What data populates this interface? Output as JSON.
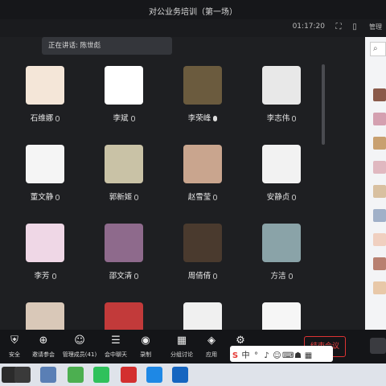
{
  "window": {
    "title": "对公业务培训（第一场）",
    "time": "01:17:20",
    "manage_label": "管理"
  },
  "speaking": {
    "label": "正在讲话: 陈世彪"
  },
  "participants": [
    {
      "name": "石维娜",
      "avatar_color": "#f4e6d8"
    },
    {
      "name": "李斌",
      "avatar_color": "#ffffff"
    },
    {
      "name": "李荣峰",
      "avatar_color": "#6b5b3e"
    },
    {
      "name": "李志伟",
      "avatar_color": "#e8e8e8"
    },
    {
      "name": "董文静",
      "avatar_color": "#f5f5f5"
    },
    {
      "name": "郭新姬",
      "avatar_color": "#c9c2a6"
    },
    {
      "name": "赵雪莹",
      "avatar_color": "#c9a58e"
    },
    {
      "name": "安静贞",
      "avatar_color": "#f2f2f2"
    },
    {
      "name": "李芳",
      "avatar_color": "#efd7e6"
    },
    {
      "name": "邵文清",
      "avatar_color": "#8e6a8c"
    },
    {
      "name": "周倩倩",
      "avatar_color": "#4a3a2e"
    },
    {
      "name": "方洁",
      "avatar_color": "#8aa3a8"
    },
    {
      "name": "",
      "avatar_color": "#d9c8b8"
    },
    {
      "name": "",
      "avatar_color": "#c23a3a"
    },
    {
      "name": "",
      "avatar_color": "#f0f0f0"
    },
    {
      "name": "",
      "avatar_color": "#f6f6f6"
    }
  ],
  "toolbar": [
    {
      "label": "安全",
      "icon": "shield-icon",
      "glyph": "⛨"
    },
    {
      "label": "邀请参会",
      "icon": "invite-icon",
      "glyph": "⊕"
    },
    {
      "label": "管理成员(41)",
      "icon": "members-icon",
      "glyph": "☺"
    },
    {
      "label": "会中聊天",
      "icon": "chat-icon",
      "glyph": "☰"
    },
    {
      "label": "录制",
      "icon": "record-icon",
      "glyph": "◉"
    },
    {
      "label": "分组讨论",
      "icon": "breakout-icon",
      "glyph": "▦"
    },
    {
      "label": "应用",
      "icon": "apps-icon",
      "glyph": "◈"
    },
    {
      "label": "",
      "icon": "settings-icon",
      "glyph": "⚙"
    }
  ],
  "end_button": {
    "label": "结束会议"
  },
  "ime": {
    "mode": "中"
  },
  "taskbar": [
    {
      "icon": "start-icon",
      "color": "#2b2b2b"
    },
    {
      "icon": "calculator-icon",
      "color": "#3a3a3a"
    },
    {
      "icon": "app-icon",
      "color": "#5a7fb5"
    },
    {
      "icon": "search-icon",
      "color": "#4caf50"
    },
    {
      "icon": "wechat-icon",
      "color": "#2fc15b"
    },
    {
      "icon": "wps-icon",
      "color": "#d32f2f"
    },
    {
      "icon": "browser-icon",
      "color": "#1e88e5"
    },
    {
      "icon": "meeting-icon",
      "color": "#1565c0"
    }
  ],
  "right_panel_colors": [
    "#8a5a4a",
    "#d4a0b0",
    "#c8a070",
    "#e0b8c0",
    "#d8c0a0",
    "#a0b0c8",
    "#f0d0c0",
    "#b88070",
    "#e8c8a8"
  ]
}
